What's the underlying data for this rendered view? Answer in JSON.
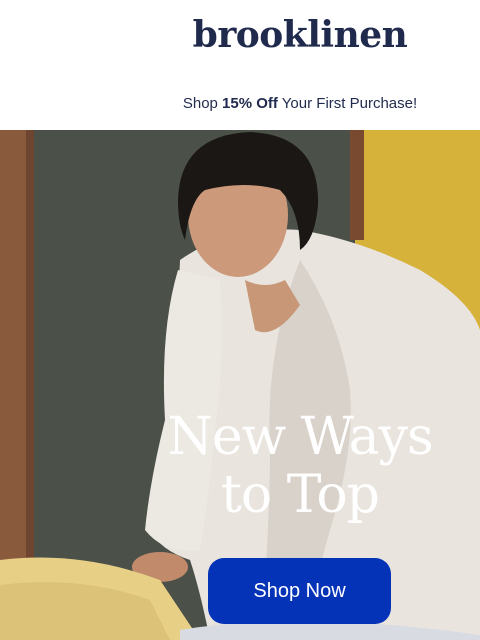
{
  "header": {
    "logo": "brooklinen",
    "promo_prefix": "Shop ",
    "promo_highlight": "15% Off",
    "promo_suffix": " Your First Purchase!"
  },
  "hero": {
    "headline_line1": "New Ways",
    "headline_line2": "to Top",
    "cta_label": "Shop Now",
    "image_subject": "person in white robe making a bed"
  },
  "colors": {
    "brand_navy": "#1f2a4d",
    "cta_blue": "#0533b8",
    "wall_yellow": "#d7b23a"
  }
}
